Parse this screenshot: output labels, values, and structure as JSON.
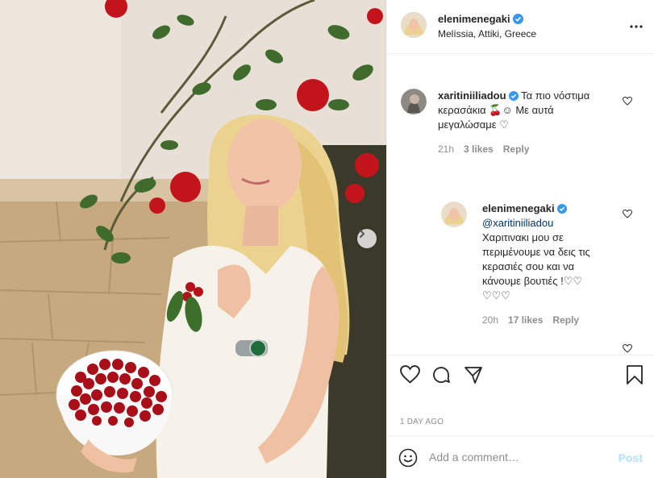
{
  "header": {
    "username": "elenimenegaki",
    "location": "Melíssia, Attiki, Greece"
  },
  "comments": [
    {
      "username": "xaritiniiliadou",
      "line1": "Τα πιο νόστιμα",
      "line2": "κερασάκια 🍒☺ Με αυτά",
      "line3": "μεγαλώσαμε ♡",
      "age": "21h",
      "likes": "3 likes",
      "reply": "Reply"
    },
    {
      "username": "elenimenegaki",
      "mention": "@xaritiniiliadou",
      "line1": "Χαριτινακι μου σε",
      "line2": "περιμένουμε να δεις τις",
      "line3": "κερασιές σου και να",
      "line4": "κάνουμε βουτιές !♡♡",
      "line5": "♡♡♡",
      "age": "20h",
      "likes": "17 likes",
      "reply": "Reply"
    }
  ],
  "time_ago": "1 DAY AGO",
  "add_comment": {
    "placeholder": "Add a comment…",
    "post_label": "Post"
  },
  "colors": {
    "verified": "#3897f0",
    "post_disabled": "#b2dffc",
    "link": "#00376b"
  },
  "icons": [
    "more-options-icon",
    "like-icon",
    "comment-icon",
    "share-icon",
    "save-icon",
    "emoji-icon",
    "next-icon",
    "verified-badge-icon"
  ]
}
